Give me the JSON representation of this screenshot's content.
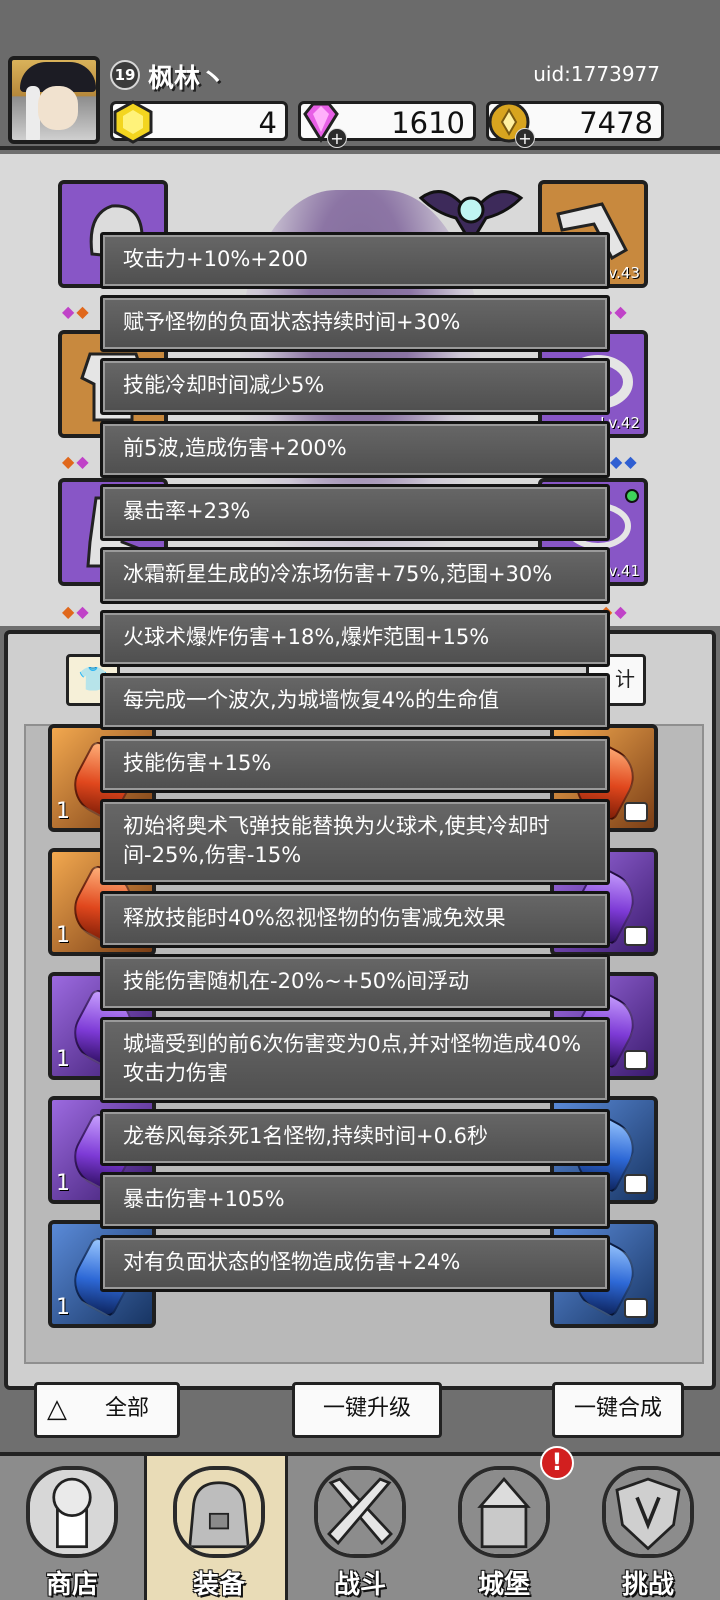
{
  "player": {
    "level": "19",
    "name": "枫林丶",
    "uid": "uid:1773977"
  },
  "currencies": [
    {
      "name": "gold-gem",
      "value": "4",
      "icon": "yellow-gem-icon",
      "color": "#f2d21c"
    },
    {
      "name": "diamond",
      "value": "1610",
      "icon": "pink-diamond-icon",
      "color": "#e45ee8"
    },
    {
      "name": "coin",
      "value": "7478",
      "icon": "gold-coin-icon",
      "color": "#d9a41f"
    }
  ],
  "equipment": {
    "slots": [
      {
        "side": "left",
        "rarity": "purple",
        "icon": "shoulder-armor-icon",
        "lv": ""
      },
      {
        "side": "left",
        "rarity": "orange",
        "icon": "chest-armor-icon",
        "lv": ""
      },
      {
        "side": "left",
        "rarity": "purple",
        "icon": "boots-icon",
        "lv": ""
      },
      {
        "side": "right",
        "rarity": "orange",
        "icon": "bone-weapon-icon",
        "lv": "Lv.43"
      },
      {
        "side": "right",
        "rarity": "purple",
        "icon": "ring-icon",
        "lv": "Lv.42"
      },
      {
        "side": "right",
        "rarity": "purple",
        "icon": "necklace-icon",
        "lv": "Lv.41"
      }
    ]
  },
  "inventory": {
    "tab_right": "计",
    "rows": [
      {
        "rarity": "orange",
        "count": "1"
      },
      {
        "rarity": "orange",
        "count": "1"
      },
      {
        "rarity": "purple",
        "count": "1"
      },
      {
        "rarity": "purple",
        "count": "1"
      },
      {
        "rarity": "blue",
        "count": "1"
      }
    ]
  },
  "buttons": {
    "filter": "全部",
    "upgrade": "一键升级",
    "merge": "一键合成"
  },
  "tooltip_lines": [
    "攻击力+10%+200",
    "赋予怪物的负面状态持续时间+30%",
    "技能冷却时间减少5%",
    "前5波,造成伤害+200%",
    "暴击率+23%",
    "冰霜新星生成的冷冻场伤害+75%,范围+30%",
    "火球术爆炸伤害+18%,爆炸范围+15%",
    "每完成一个波次,为城墙恢复4%的生命值",
    "技能伤害+15%",
    "初始将奥术飞弹技能替换为火球术,使其冷却时间-25%,伤害-15%",
    "释放技能时40%忽视怪物的伤害减免效果",
    "技能伤害随机在-20%~+50%间浮动",
    "城墙受到的前6次伤害变为0点,并对怪物造成40%攻击力伤害",
    "龙卷风每杀死1名怪物,持续时间+0.6秒",
    "暴击伤害+105%",
    "对有负面状态的怪物造成伤害+24%"
  ],
  "nav": [
    {
      "label": "商店",
      "icon": "shop-icon",
      "active": false
    },
    {
      "label": "装备",
      "icon": "equipment-bag-icon",
      "active": true
    },
    {
      "label": "战斗",
      "icon": "crossed-swords-icon",
      "active": false
    },
    {
      "label": "城堡",
      "icon": "castle-icon",
      "active": false,
      "alert": "!"
    },
    {
      "label": "挑战",
      "icon": "challenge-shield-icon",
      "active": false
    }
  ]
}
